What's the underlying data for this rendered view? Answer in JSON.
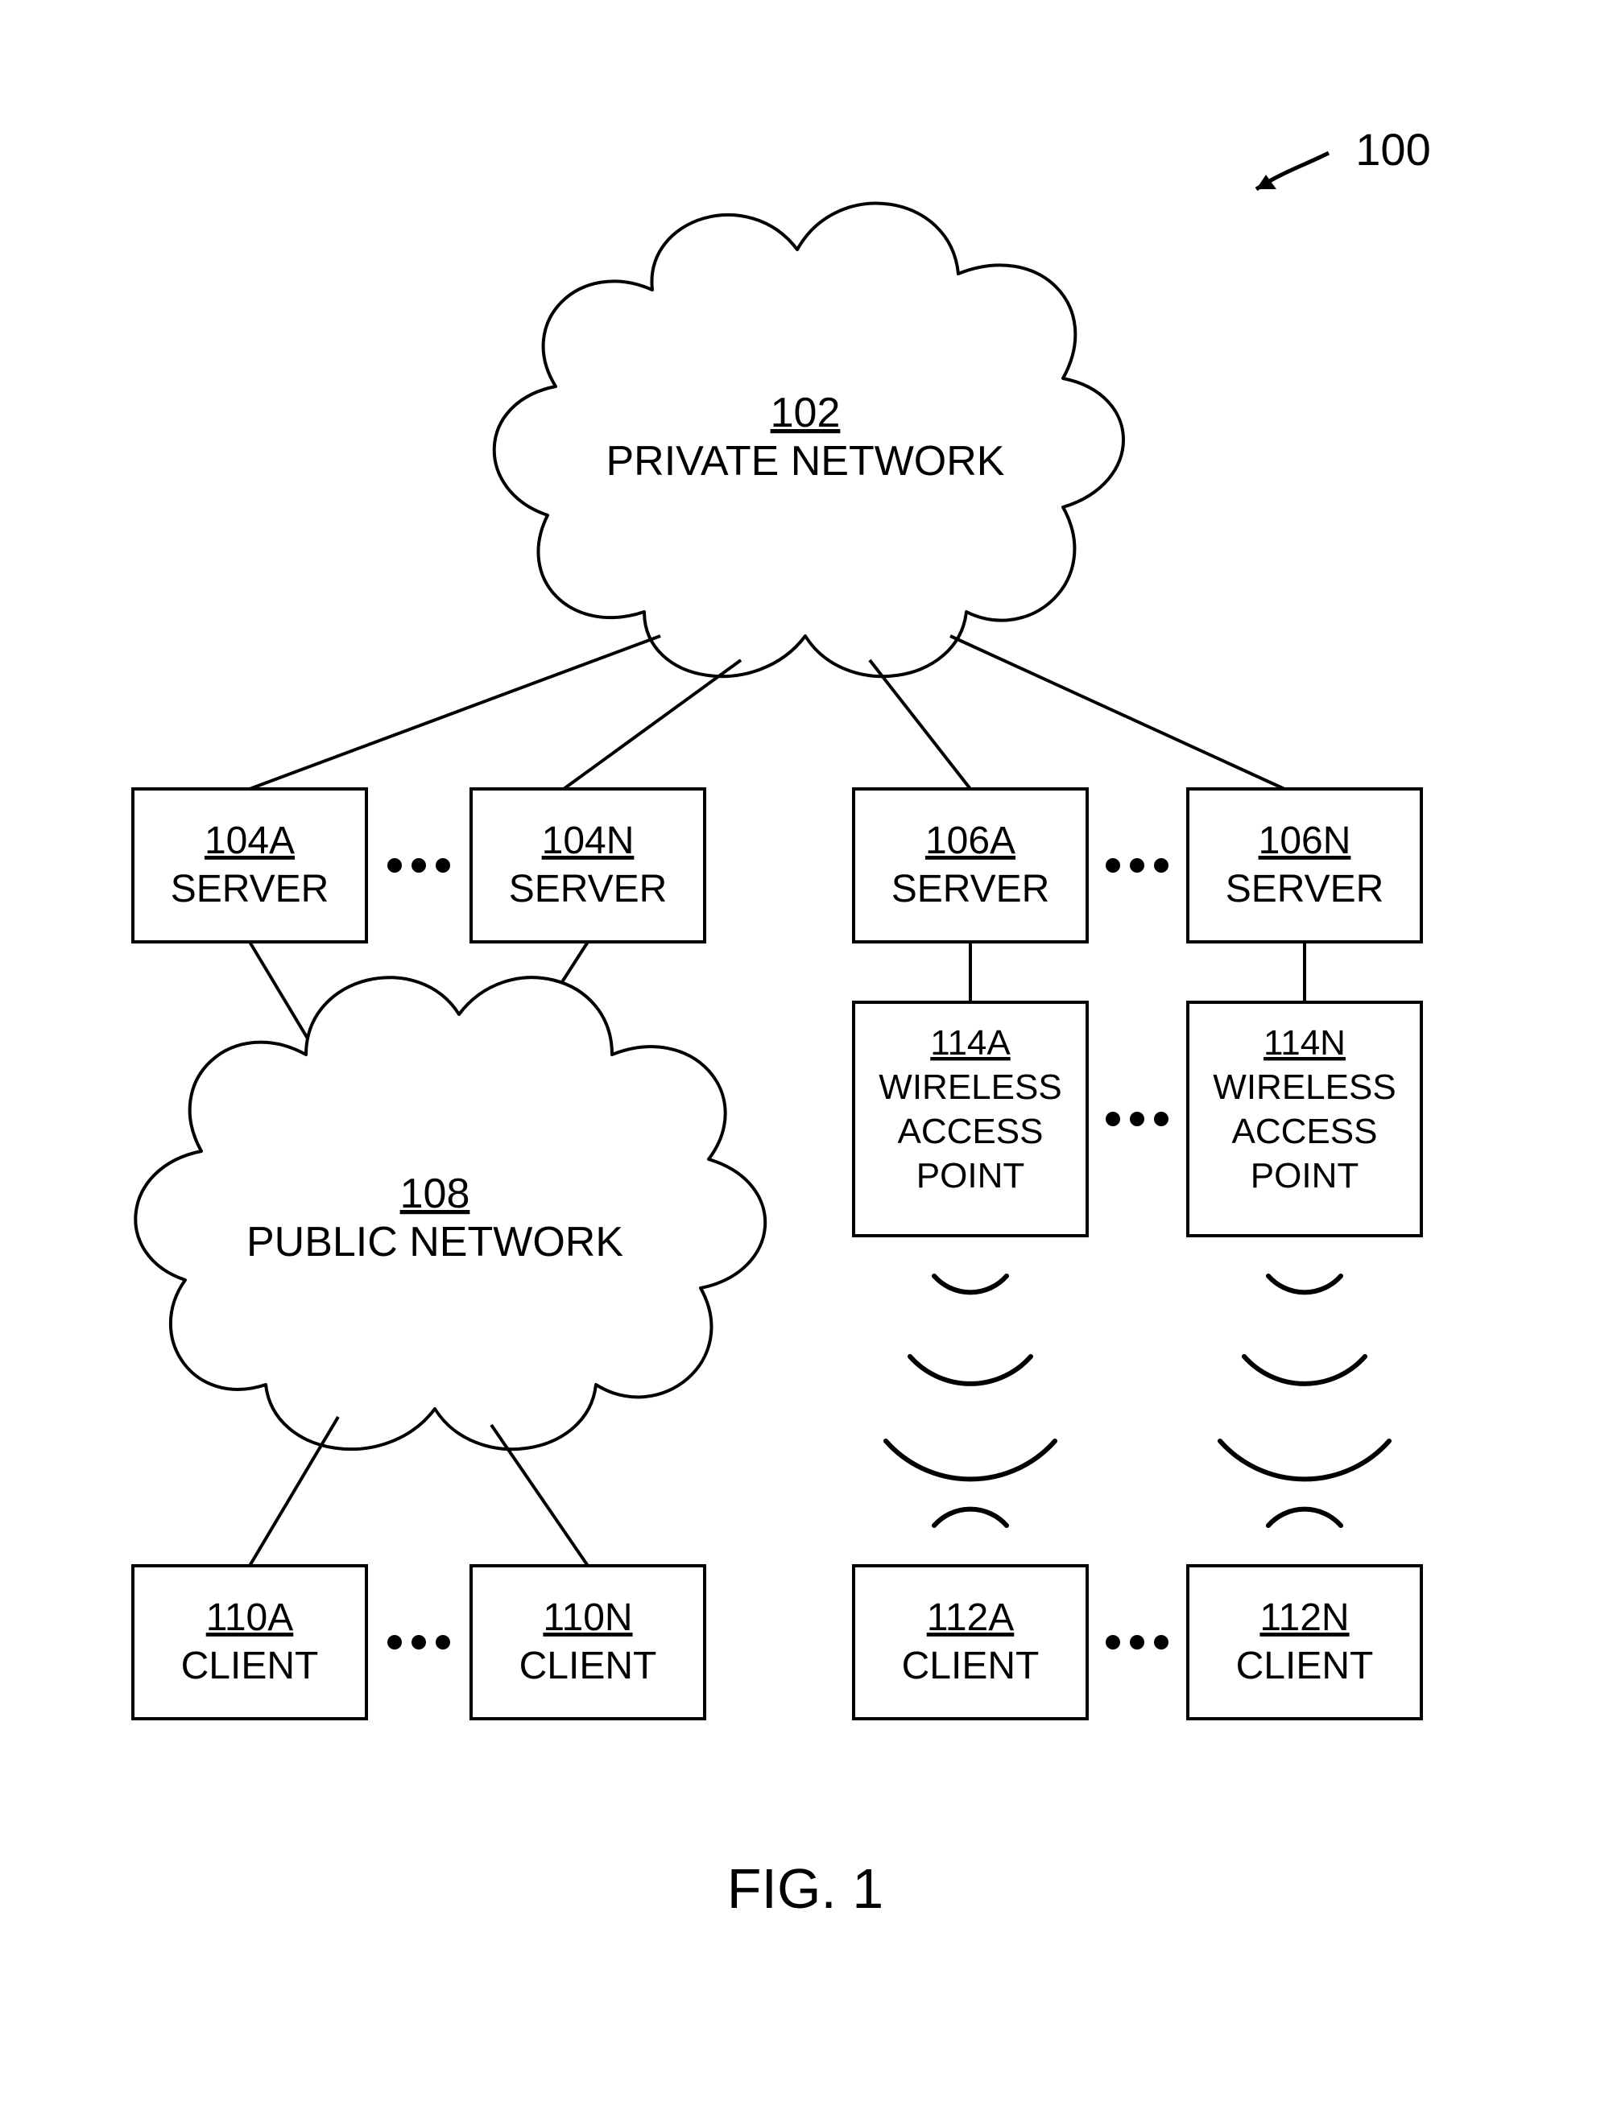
{
  "figure_ref": "100",
  "caption": "FIG. 1",
  "private_network": {
    "ref": "102",
    "label": "PRIVATE NETWORK"
  },
  "public_network": {
    "ref": "108",
    "label": "PUBLIC NETWORK"
  },
  "servers_left": {
    "a": {
      "ref": "104A",
      "label": "SERVER"
    },
    "n": {
      "ref": "104N",
      "label": "SERVER"
    }
  },
  "servers_right": {
    "a": {
      "ref": "106A",
      "label": "SERVER"
    },
    "n": {
      "ref": "106N",
      "label": "SERVER"
    }
  },
  "waps": {
    "a": {
      "ref": "114A",
      "l1": "WIRELESS",
      "l2": "ACCESS",
      "l3": "POINT"
    },
    "n": {
      "ref": "114N",
      "l1": "WIRELESS",
      "l2": "ACCESS",
      "l3": "POINT"
    }
  },
  "clients_left": {
    "a": {
      "ref": "110A",
      "label": "CLIENT"
    },
    "n": {
      "ref": "110N",
      "label": "CLIENT"
    }
  },
  "clients_right": {
    "a": {
      "ref": "112A",
      "label": "CLIENT"
    },
    "n": {
      "ref": "112N",
      "label": "CLIENT"
    }
  }
}
